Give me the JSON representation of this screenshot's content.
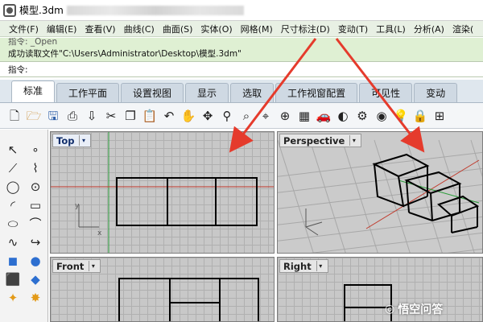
{
  "window": {
    "title": "模型.3dm",
    "icon": "rhino-icon"
  },
  "menu": {
    "items": [
      "文件(F)",
      "编辑(E)",
      "查看(V)",
      "曲线(C)",
      "曲面(S)",
      "实体(O)",
      "网格(M)",
      "尺寸标注(D)",
      "变动(T)",
      "工具(L)",
      "分析(A)",
      "渲染("
    ]
  },
  "command": {
    "history_line": "指令: _Open",
    "status_line": "成功读取文件\"C:\\Users\\Administrator\\Desktop\\模型.3dm\"",
    "prompt_label": "指令:"
  },
  "tabs": {
    "items": [
      "标准",
      "工作平面",
      "设置视图",
      "显示",
      "选取",
      "工作视窗配置",
      "可见性",
      "变动"
    ],
    "active_index": 0
  },
  "toolbar": {
    "icons": [
      "new-file-icon",
      "open-folder-icon",
      "save-icon",
      "print-icon",
      "import-icon",
      "cut-icon",
      "copy-icon",
      "paste-icon",
      "undo-icon",
      "pan-hand-icon",
      "rotate-view-icon",
      "zoom-dynamic-icon",
      "zoom-window-icon",
      "zoom-extents-icon",
      "zoom-selected-icon",
      "four-view-icon",
      "car-icon",
      "render-icon",
      "gear-icon",
      "display-mode-icon",
      "light-bulb-icon",
      "lock-icon",
      "grid-snap-icon"
    ]
  },
  "left_panel": {
    "icons": [
      "select-arrow-icon",
      "point-icon",
      "polyline-icon",
      "control-point-curve-icon",
      "circle-icon",
      "circle-center-icon",
      "arc-icon",
      "rectangle-icon",
      "ellipse-icon",
      "fillet-icon",
      "blend-icon",
      "curve-from-object-icon",
      "box-icon",
      "sphere-icon",
      "extrude-icon",
      "surface-icon",
      "transform-icon",
      "explode-icon"
    ]
  },
  "viewports": {
    "top": {
      "label": "Top"
    },
    "perspective": {
      "label": "Perspective"
    },
    "front": {
      "label": "Front"
    },
    "right": {
      "label": "Right"
    }
  },
  "watermark": {
    "text": "悟空问答"
  },
  "colors": {
    "menu_bg": "#e8f0e4",
    "command_bg": "#dff0d3",
    "viewport_bg": "#c8c8c8",
    "grid_line": "#b0b0b0",
    "axis_red": "#c0392b",
    "axis_green": "#2a9d3a",
    "annotation_red": "#e53b2c"
  }
}
